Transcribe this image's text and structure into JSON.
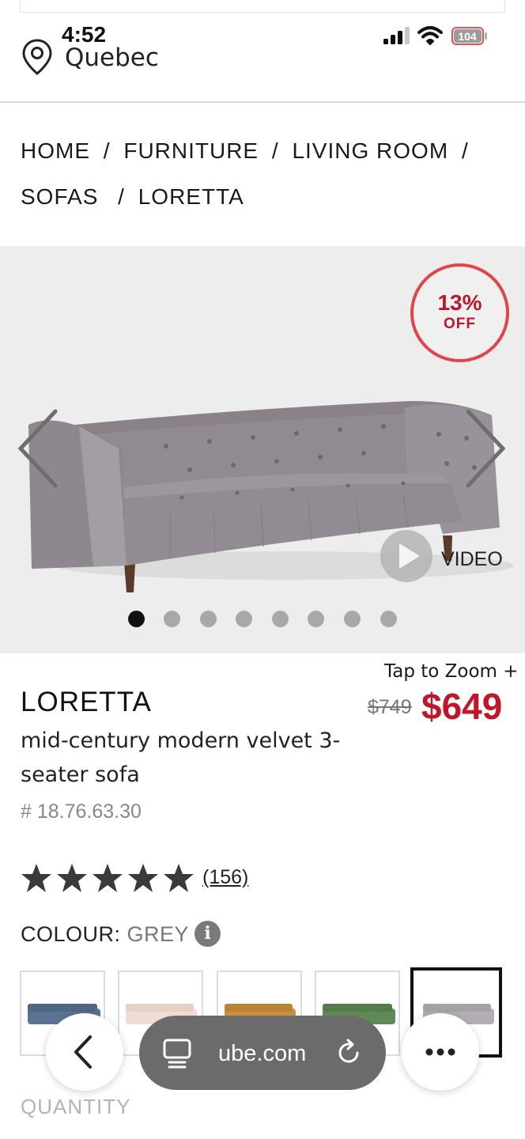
{
  "status_bar": {
    "time": "4:52",
    "location": "Quebec",
    "battery": "104"
  },
  "breadcrumb": {
    "line1": [
      "HOME",
      "/",
      "FURNITURE",
      "/",
      "LIVING ROOM",
      "/"
    ],
    "line2": [
      "SOFAS",
      "/",
      "LORETTA"
    ]
  },
  "gallery": {
    "badge_percent": "13%",
    "badge_off": "OFF",
    "video_label": "VIDEO",
    "dot_count": 8,
    "active_dot": 1,
    "sofa_color": "#8f8790"
  },
  "product": {
    "tap_to_zoom": "Tap to Zoom +",
    "name": "LORETTA",
    "description": "mid-century modern velvet 3-seater sofa",
    "sku": "# 18.76.63.30",
    "old_price": "$749",
    "new_price": "$649",
    "rating": 5,
    "review_count": "(156)",
    "colour_label": "COLOUR:",
    "colour_value": "GREY",
    "swatches": [
      {
        "name": "blue",
        "color": "#5b7293"
      },
      {
        "name": "blush",
        "color": "#efdcd2"
      },
      {
        "name": "mustard",
        "color": "#c9913f"
      },
      {
        "name": "green",
        "color": "#5f8a55"
      },
      {
        "name": "grey",
        "color": "#b3aeb3"
      }
    ],
    "quantity_label": "QUANTITY"
  },
  "browser": {
    "url": "ube.com"
  },
  "colors": {
    "accent": "#c0162b",
    "badge_ring": "#e0454b"
  }
}
